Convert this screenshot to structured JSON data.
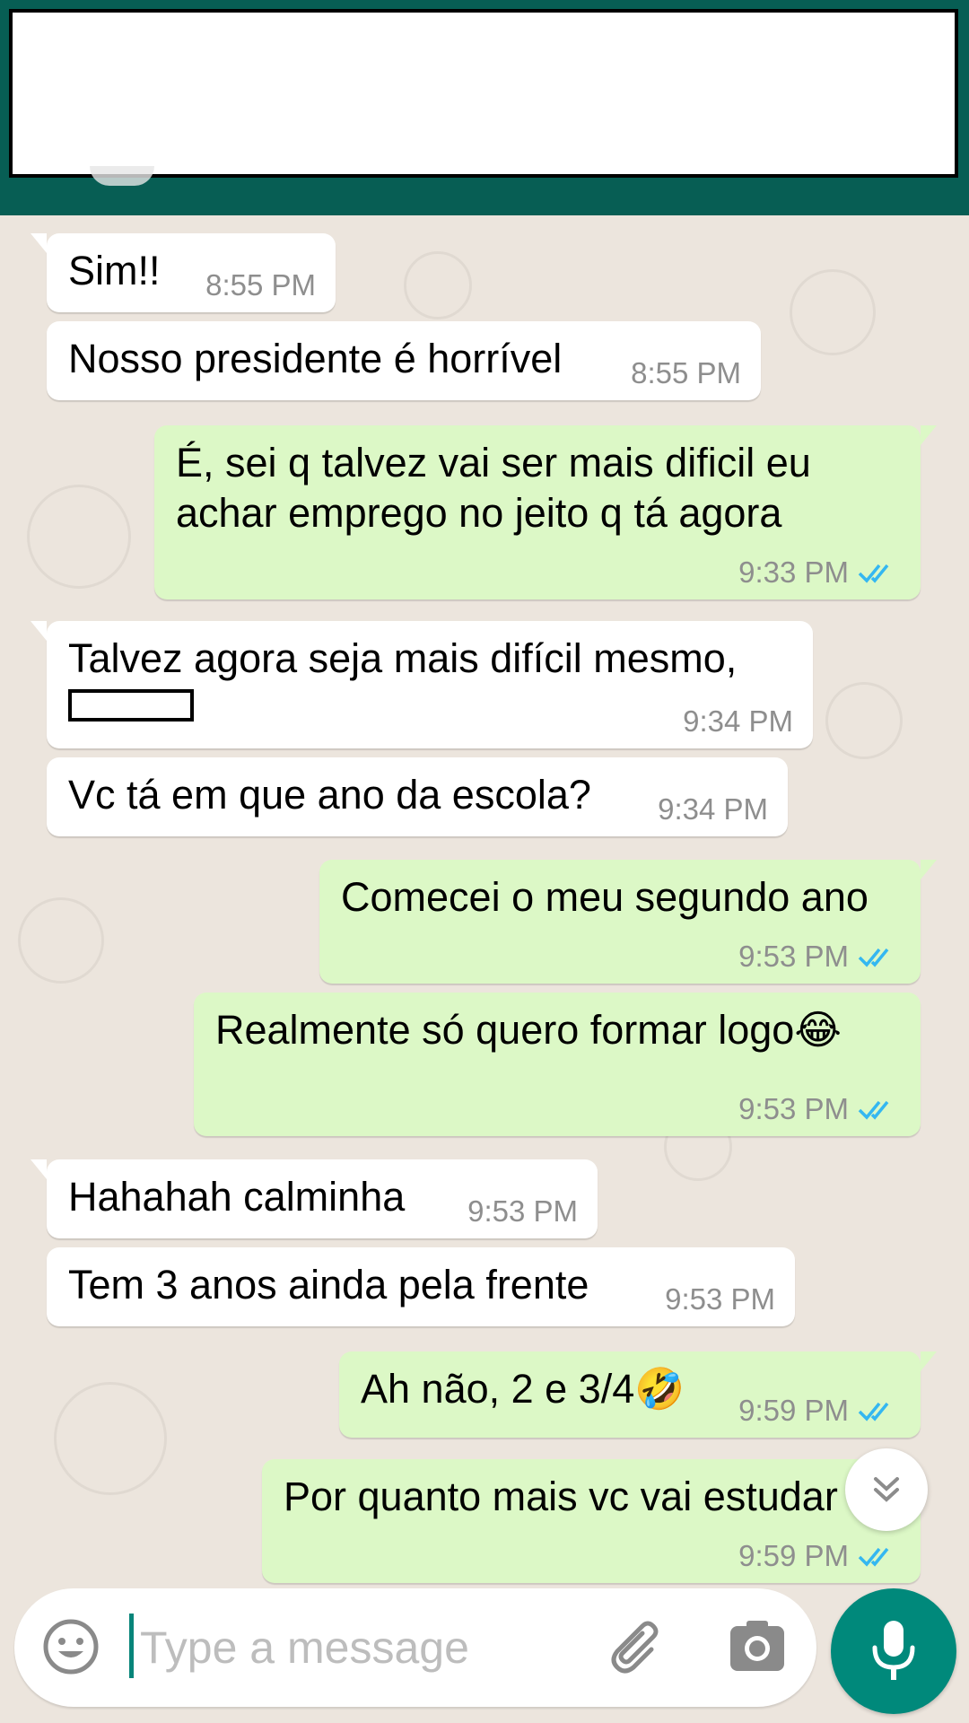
{
  "composer": {
    "placeholder": "Type a message"
  },
  "messages": [
    {
      "dir": "in",
      "text": "Sim!!",
      "time": "8:55 PM"
    },
    {
      "dir": "in",
      "text": "Nosso presidente é horrível",
      "time": "8:55 PM"
    },
    {
      "dir": "out",
      "text": "É, sei q talvez vai ser mais dificil eu\nachar emprego no jeito q tá agora",
      "time": "9:33 PM"
    },
    {
      "dir": "in",
      "text": "Talvez agora seja mais difícil mesmo,",
      "time": "9:34 PM"
    },
    {
      "dir": "in",
      "text": "Vc tá em que ano da escola?",
      "time": "9:34 PM"
    },
    {
      "dir": "out",
      "text": "Comecei o meu segundo ano",
      "time": "9:53 PM"
    },
    {
      "dir": "out",
      "text": "Realmente só quero formar logo😂",
      "time": "9:53 PM"
    },
    {
      "dir": "in",
      "text": "Hahahah calminha",
      "time": "9:53 PM"
    },
    {
      "dir": "in",
      "text": "Tem 3 anos ainda pela frente",
      "time": "9:53 PM"
    },
    {
      "dir": "out",
      "text": "Ah não, 2 e 3/4🤣",
      "time": "9:59 PM"
    },
    {
      "dir": "out",
      "text": "Por quanto mais vc vai estudar",
      "time": "9:59 PM"
    }
  ],
  "icons": {
    "read_receipt": "double-check-icon",
    "tick_color": "#34b7f1",
    "emoji_button": "smiley-icon",
    "attach": "paperclip-icon",
    "camera": "camera-icon",
    "mic": "microphone-icon",
    "scroll_down": "chevron-double-down-icon"
  },
  "colors": {
    "header": "#075e54",
    "outgoing_bubble": "#dcf8c6",
    "incoming_bubble": "#ffffff",
    "mic_button": "#00897b",
    "chat_background": "#ece5dd"
  }
}
